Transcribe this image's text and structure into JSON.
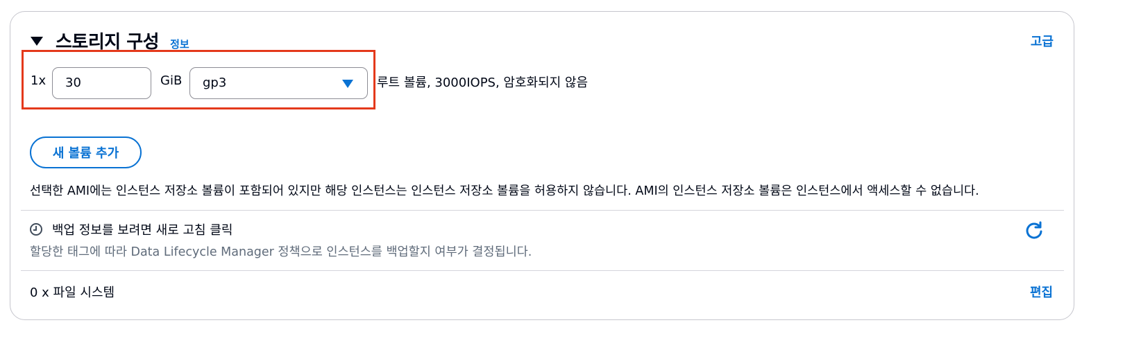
{
  "section": {
    "title": "스토리지 구성",
    "info_link": "정보",
    "advanced_link": "고급"
  },
  "volume": {
    "count_label": "1x",
    "size_value": "30",
    "unit_label": "GiB",
    "type_value": "gp3",
    "description": "루트 볼륨,  3000IOPS,  암호화되지 않음"
  },
  "add_volume_button": "새 볼륨 추가",
  "notice": "선택한 AMI에는 인스턴스 저장소 볼륨이 포함되어 있지만 해당 인스턴스는 인스턴스 저장소 볼륨을 허용하지 않습니다. AMI의 인스턴스 저장소 볼륨은 인스턴스에서 액세스할 수 없습니다.",
  "backup": {
    "title": "백업 정보를 보려면 새로 고침 클릭",
    "description": "할당한 태그에 따라 Data Lifecycle Manager 정책으로 인스턴스를 백업할지 여부가 결정됩니다.",
    "icon": "clock-icon",
    "refresh_icon": "refresh-icon"
  },
  "file_systems": {
    "label": "0 x 파일 시스템",
    "edit_link": "편집"
  },
  "colors": {
    "accent": "#0972d3",
    "highlight": "#e4391b",
    "text": "#000716",
    "muted": "#5f6b7a"
  }
}
